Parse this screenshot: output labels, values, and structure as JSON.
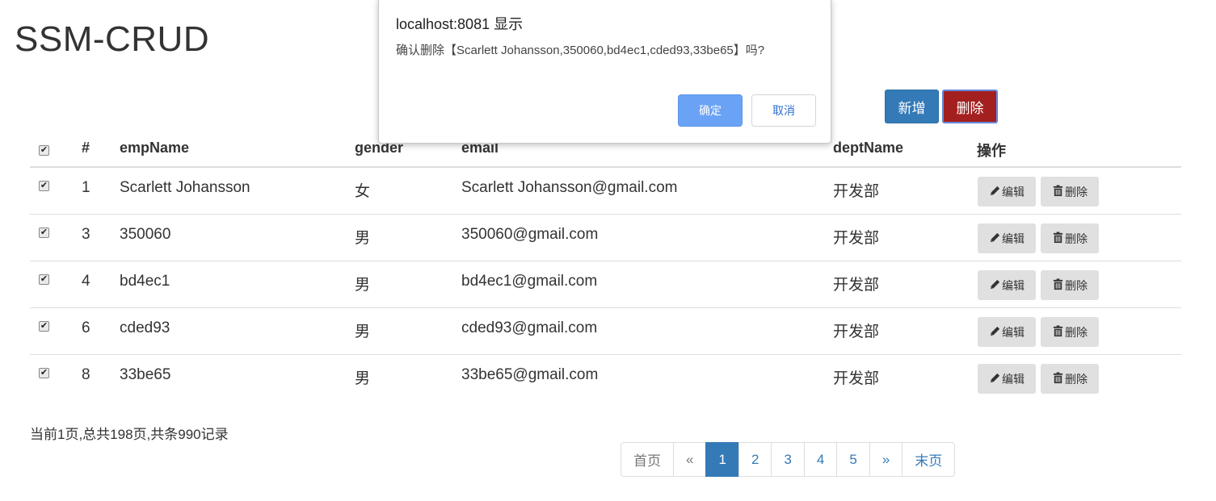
{
  "page": {
    "title": "SSM-CRUD"
  },
  "toolbar": {
    "add_label": "新增",
    "delete_label": "删除"
  },
  "table": {
    "headers": {
      "check": "✔",
      "id": "#",
      "name": "empName",
      "gender": "gender",
      "email": "email",
      "dept": "deptName",
      "ops": "操作"
    },
    "edit_label": "编辑",
    "remove_label": "删除",
    "rows": [
      {
        "id": "1",
        "name": "Scarlett Johansson",
        "gender": "女",
        "email": "Scarlett Johansson@gmail.com",
        "dept": "开发部"
      },
      {
        "id": "3",
        "name": "350060",
        "gender": "男",
        "email": "350060@gmail.com",
        "dept": "开发部"
      },
      {
        "id": "4",
        "name": "bd4ec1",
        "gender": "男",
        "email": "bd4ec1@gmail.com",
        "dept": "开发部"
      },
      {
        "id": "6",
        "name": "cded93",
        "gender": "男",
        "email": "cded93@gmail.com",
        "dept": "开发部"
      },
      {
        "id": "8",
        "name": "33be65",
        "gender": "男",
        "email": "33be65@gmail.com",
        "dept": "开发部"
      }
    ]
  },
  "paging": {
    "info": "当前1页,总共198页,共条990记录",
    "first": "首页",
    "prev": "«",
    "pages": [
      "1",
      "2",
      "3",
      "4",
      "5"
    ],
    "active_page": "1",
    "next": "»",
    "last": "末页"
  },
  "dialog": {
    "title": "localhost:8081 显示",
    "message": "确认删除【Scarlett Johansson,350060,bd4ec1,cded93,33be65】吗?",
    "ok_label": "确定",
    "cancel_label": "取消"
  },
  "colors": {
    "primary": "#337ab7",
    "danger": "#a41f1f",
    "dialog_ok": "#6aa3f5"
  }
}
